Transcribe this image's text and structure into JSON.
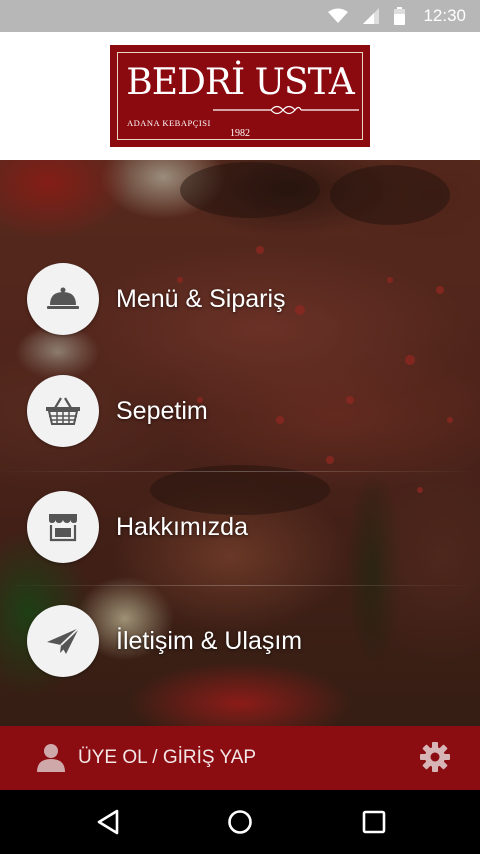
{
  "status_bar": {
    "time": "12:30",
    "icons": [
      "wifi-icon",
      "cell-signal-icon",
      "battery-icon"
    ]
  },
  "logo": {
    "title": "BEDRİ USTA",
    "subtitle": "ADANA KEBAPÇISI",
    "year": "1982",
    "brand_color": "#8b0a10"
  },
  "menu": {
    "items": [
      {
        "label": "Menü & Sipariş",
        "icon": "cloche-icon"
      },
      {
        "label": "Sepetim",
        "icon": "basket-icon"
      },
      {
        "label": "Hakkımızda",
        "icon": "storefront-icon"
      },
      {
        "label": "İletişim & Ulaşım",
        "icon": "paper-plane-icon"
      }
    ]
  },
  "login_bar": {
    "label": "ÜYE OL / GİRİŞ YAP",
    "user_icon": "user-icon",
    "settings_icon": "gear-icon",
    "color": "#8b0d12"
  },
  "nav_bar": {
    "icons": [
      "back-icon",
      "home-icon",
      "recents-icon"
    ]
  }
}
